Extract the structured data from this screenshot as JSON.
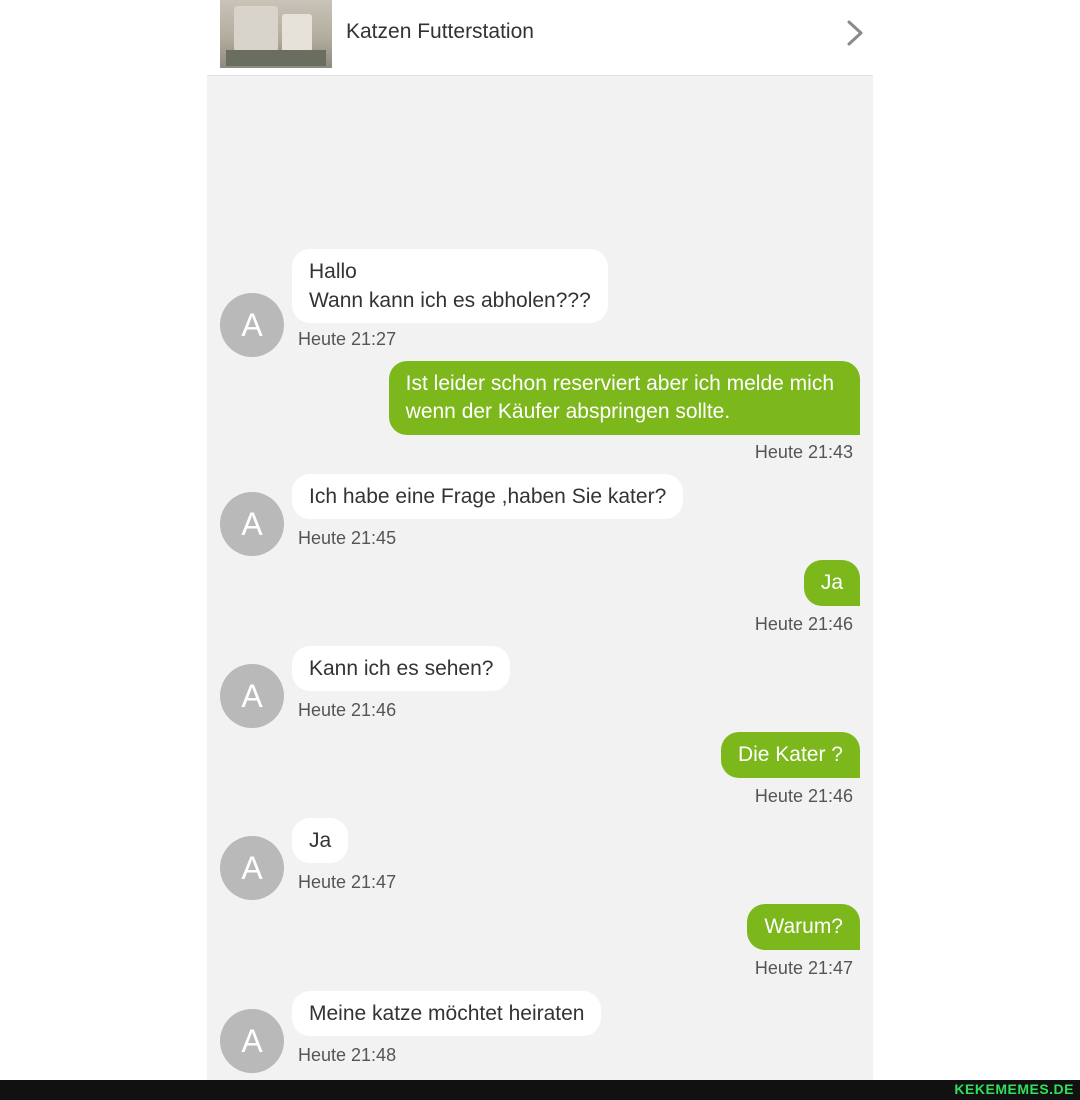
{
  "header": {
    "title": "Katzen Futterstation",
    "chevron_icon": "chevron-right-icon"
  },
  "messages": [
    {
      "side": "in",
      "avatar": "A",
      "lines": [
        "Hallo",
        "Wann kann ich es abholen???"
      ],
      "time": "Heute 21:27"
    },
    {
      "side": "out",
      "lines": [
        "Ist leider schon reserviert aber ich melde mich",
        "wenn der Käufer abspringen sollte."
      ],
      "time": "Heute 21:43"
    },
    {
      "side": "in",
      "avatar": "A",
      "lines": [
        "Ich habe eine Frage ,haben Sie kater?"
      ],
      "time": "Heute 21:45"
    },
    {
      "side": "out",
      "lines": [
        "Ja"
      ],
      "time": "Heute 21:46"
    },
    {
      "side": "in",
      "avatar": "A",
      "lines": [
        "Kann ich es sehen?"
      ],
      "time": "Heute 21:46"
    },
    {
      "side": "out",
      "lines": [
        "Die Kater ?"
      ],
      "time": "Heute 21:46"
    },
    {
      "side": "in",
      "avatar": "A",
      "lines": [
        "Ja"
      ],
      "time": "Heute 21:47"
    },
    {
      "side": "out",
      "lines": [
        "Warum?"
      ],
      "time": "Heute 21:47"
    },
    {
      "side": "in",
      "avatar": "A",
      "lines": [
        "Meine katze möchtet heiraten"
      ],
      "time": "Heute 21:48"
    }
  ],
  "watermark": "KEKEMEMES.DE",
  "colors": {
    "outgoing_bubble": "#7cb81c",
    "incoming_bubble": "#ffffff",
    "avatar": "#b9b9b9",
    "chat_background": "#f2f2f2"
  }
}
